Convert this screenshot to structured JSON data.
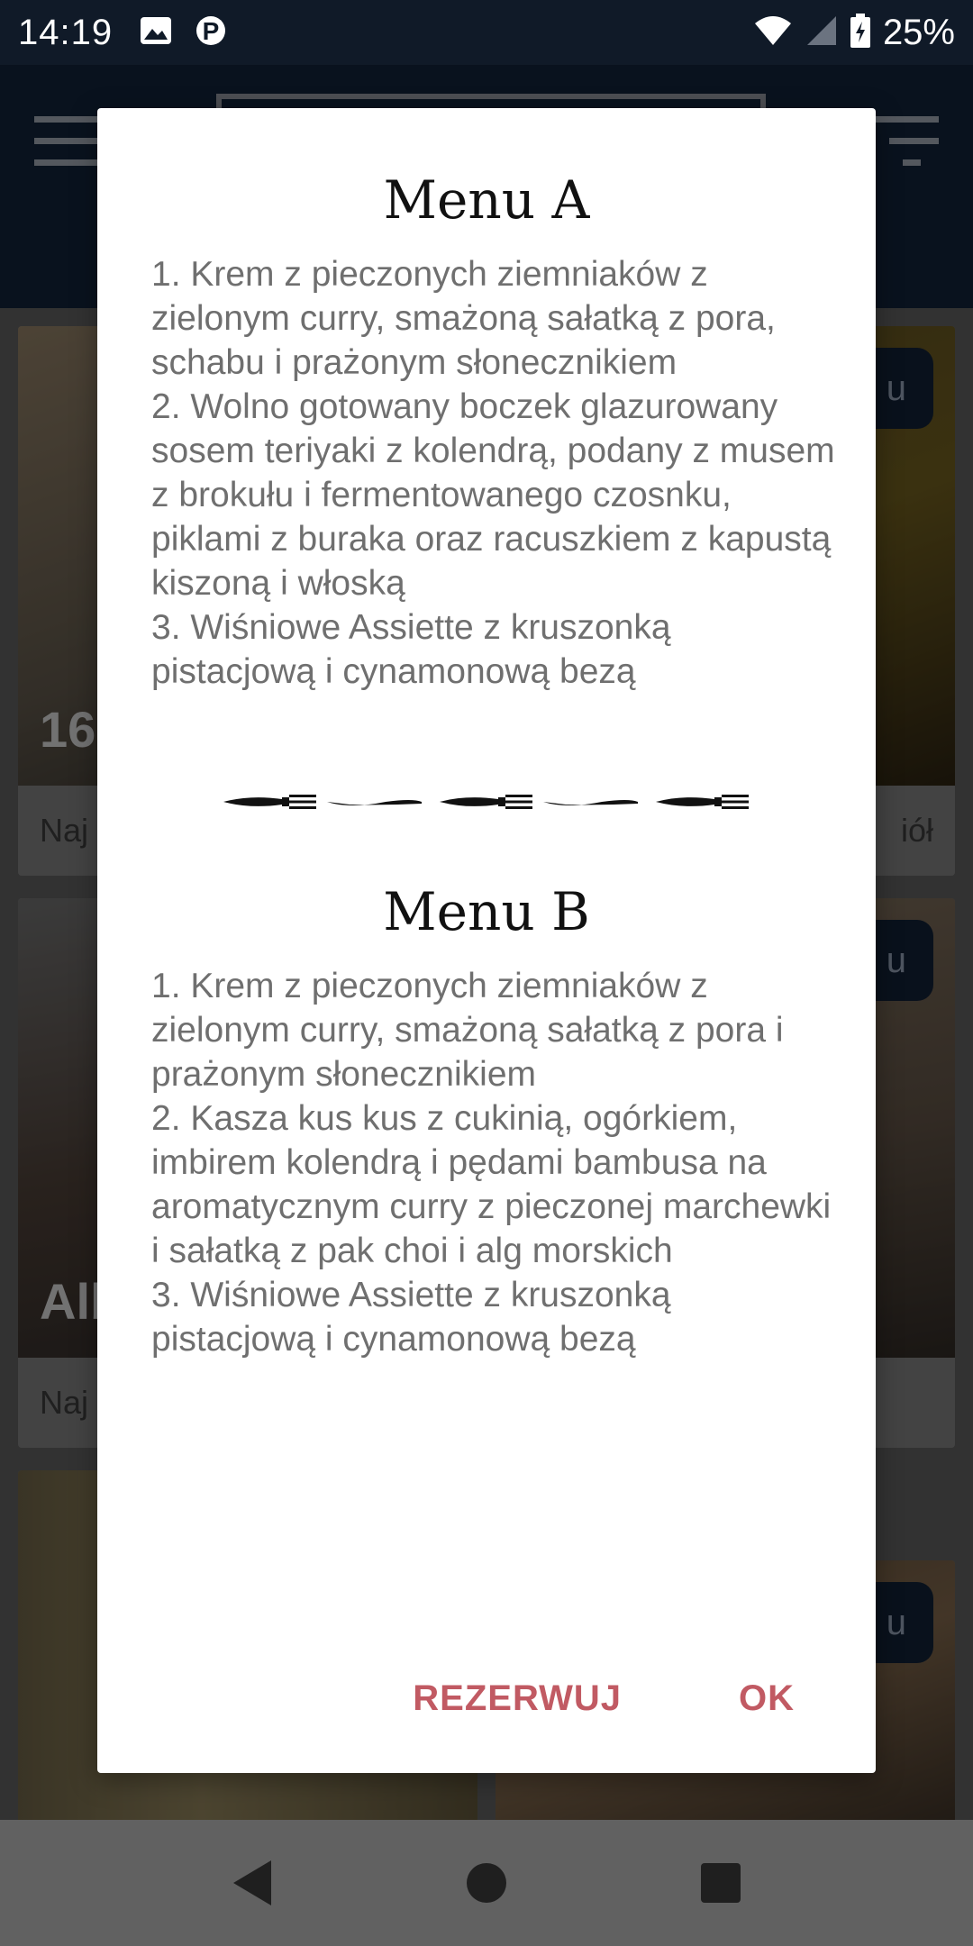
{
  "status_bar": {
    "time": "14:19",
    "battery": "25%",
    "icons": [
      "image-icon",
      "parking-icon",
      "wifi-icon",
      "signal-icon",
      "battery-charging-icon"
    ]
  },
  "background": {
    "cards": [
      {
        "big_text": "16",
        "caption": "Naj",
        "pill": ""
      },
      {
        "big_text": "",
        "caption": "iół",
        "pill": "u"
      },
      {
        "big_text": "Alb",
        "caption": "Naj",
        "pill": ""
      },
      {
        "big_text": "",
        "caption": "",
        "pill": "u"
      },
      {
        "big_text": "",
        "caption": "",
        "pill": "u"
      }
    ]
  },
  "dialog": {
    "menu_a": {
      "title": "Menu A",
      "body": "1. Krem z pieczonych ziemniaków z zielonym curry, smażoną sałatką z pora, schabu i prażonym słonecznikiem\n2. Wolno gotowany boczek glazurowany sosem teriyaki z kolendrą, podany z musem z brokułu i fermentowanego czosnku, piklami z buraka oraz racuszkiem z kapustą kiszoną i włoską\n3. Wiśniowe Assiette z kruszonką pistacjową i cynamonową bezą"
    },
    "menu_b": {
      "title": "Menu B",
      "body": "1. Krem z pieczonych ziemniaków z zielonym curry, smażoną sałatką z pora i prażonym słonecznikiem\n2. Kasza kus kus z cukinią, ogórkiem, imbirem kolendrą i pędami bambusa na aromatycznym curry z pieczonej marchewki i sałatką z pak choi i alg morskich\n3. Wiśniowe Assiette z kruszonką pistacjową i cynamonową bezą"
    },
    "divider_icon": "cutlery-divider-icon",
    "buttons": {
      "reserve": "REZERWUJ",
      "ok": "OK"
    },
    "accent_color": "#c15a63"
  },
  "nav_bar": {
    "icons": [
      "back-icon",
      "home-icon",
      "recents-icon"
    ]
  }
}
